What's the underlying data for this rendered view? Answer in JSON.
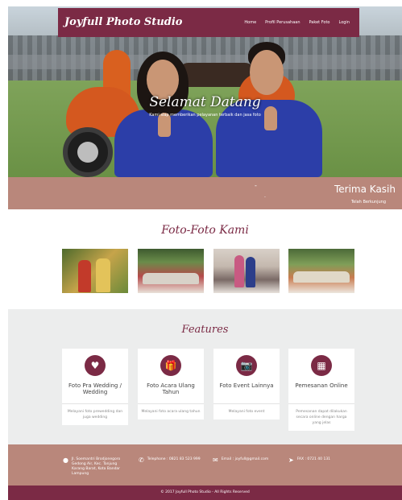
{
  "brand": "Joyfull Photo Studio",
  "nav": {
    "items": [
      "Home",
      "Profil Perusahaan",
      "Paket Foto",
      "Login"
    ]
  },
  "hero": {
    "welcome": "Selamat Datang",
    "sub": "Kami siap memberikan pelayanan terbaik dan jasa foto"
  },
  "banner": {
    "dash1": "-",
    "dash2": "-",
    "title": "Terima Kasih",
    "sub": "Telah Berkunjung"
  },
  "gallery": {
    "title": "Foto-Foto Kami"
  },
  "features": {
    "title": "Features",
    "cards": [
      {
        "icon": "heart-icon",
        "glyph": "♥",
        "title": "Foto Pra Wedding / Wedding",
        "desc": "Melayani foto prewedding dan juga wedding"
      },
      {
        "icon": "gift-icon",
        "glyph": "🎁",
        "title": "Foto Acara Ulang Tahun",
        "desc": "Melayani foto acara ulang tahun"
      },
      {
        "icon": "camera-icon",
        "glyph": "📷",
        "title": "Foto Event Lainnya",
        "desc": "Melayani foto event"
      },
      {
        "icon": "calendar-icon",
        "glyph": "▦",
        "title": "Pemesanan Online",
        "desc": "Pemesanan dapat dilakukan secara online dengan harga yang jelas"
      }
    ]
  },
  "footer": {
    "address": "Jl. Soemantri Brodjonegoro Gedong Air, Kec. Tanjung Karang Barat, Kota Bandar Lampung",
    "telephone": "Telephone : 0821 83 523 999",
    "email": "Email : joyfull@gmail.com",
    "fax": "FAX : 0721 40 131",
    "copyright": "© 2017 Joyfull Photo Studio - All Rights Reserved"
  },
  "colors": {
    "primary": "#7b2a45",
    "accent": "#b9877b",
    "section_bg": "#eceded"
  }
}
